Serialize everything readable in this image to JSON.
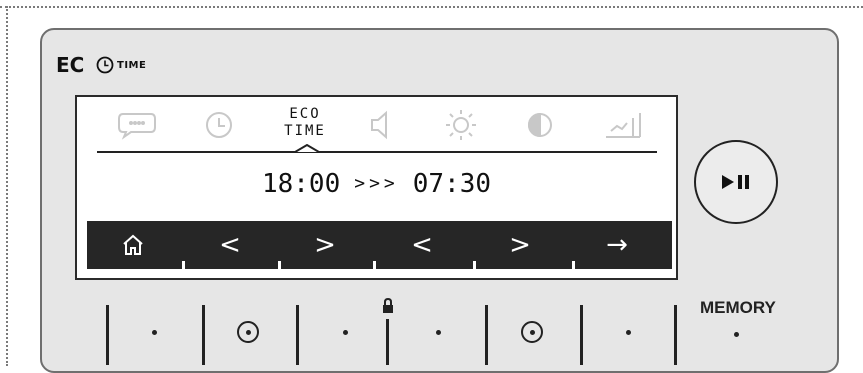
{
  "brand": {
    "logo_text": "EC",
    "logo_suffix": "TIME"
  },
  "screen": {
    "icons": [
      "chat-bubble-icon",
      "clock-icon",
      "eco-time-label",
      "speaker-icon",
      "brightness-icon",
      "contrast-icon",
      "chart-icon"
    ],
    "eco_label_line1": "ECO",
    "eco_label_line2": "TIME",
    "time_start": "18:00",
    "time_arrows": ">>>",
    "time_end": "07:30",
    "nav": [
      "home-icon",
      "<",
      ">",
      "<",
      ">",
      "→"
    ]
  },
  "play_pause": {
    "icon": "play-pause-icon"
  },
  "memory": {
    "label": "MEMORY"
  },
  "colors": {
    "panel_bg": "#e6e6e6",
    "screen_bg": "#ffffff",
    "nav_bar": "#262626",
    "icon_inactive": "#c8c8c8"
  }
}
